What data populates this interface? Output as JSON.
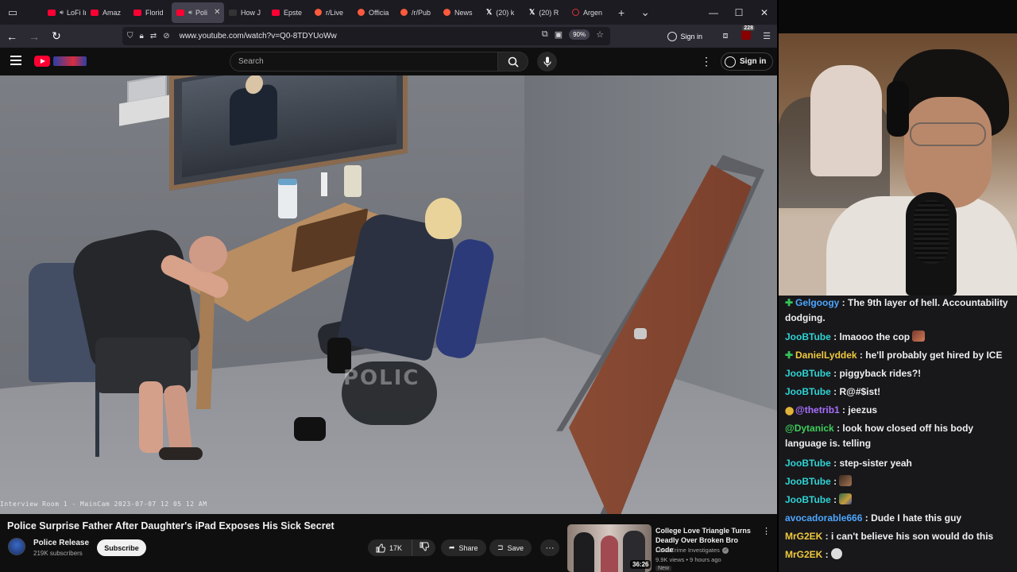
{
  "browser": {
    "tabs": [
      {
        "icon": "youtube",
        "label": "LoFi In",
        "audio": true
      },
      {
        "icon": "youtube",
        "label": "Amaz"
      },
      {
        "icon": "youtube",
        "label": "Florid"
      },
      {
        "icon": "youtube",
        "label": "Poli",
        "audio": true,
        "active": true
      },
      {
        "icon": "dark",
        "label": "How J"
      },
      {
        "icon": "youtube",
        "label": "Epste"
      },
      {
        "icon": "reddit",
        "label": "r/Live"
      },
      {
        "icon": "reddit",
        "label": "Officia"
      },
      {
        "icon": "reddit",
        "label": "/r/Pub"
      },
      {
        "icon": "reddit",
        "label": "News"
      },
      {
        "icon": "x",
        "label": "(20) k"
      },
      {
        "icon": "x",
        "label": "(20) R"
      },
      {
        "icon": "ring",
        "label": "Argen"
      }
    ],
    "url": "www.youtube.com/watch?v=Q0-8TDYUoWw",
    "zoom": "90%",
    "signin_label": "Sign in",
    "ublock_count": "228"
  },
  "youtube": {
    "search_placeholder": "Search",
    "signin_label": "Sign in",
    "video_overlay": "Interview Room 1 - MainCam 2023-07-07 12 05 12 AM",
    "watermark": "POLIC",
    "title": "Police Surprise Father After Daughter's iPad Exposes His Sick Secret",
    "channel": "Police Release",
    "subscribers": "219K subscribers",
    "subscribe_label": "Subscribe",
    "likes": "17K",
    "share_label": "Share",
    "save_label": "Save",
    "recommended": {
      "title": "College Love Triangle Turns Deadly Over Broken Bro Code",
      "channel": "Law&Crime Investigates",
      "meta": "9.9K views • 9 hours ago",
      "badge": "New",
      "duration": "36:26"
    }
  },
  "chat": {
    "colors": {
      "green": "#36c25a",
      "yellow": "#e0b33a",
      "blue": "#4da6ff",
      "purple": "#a970ff",
      "cyan": "#2fd3d3",
      "teal": "#00c8af"
    },
    "messages": [
      {
        "user": "Gelgoogy",
        "text": "The 9th layer of hell. Accountability dodging.",
        "badge": "plus",
        "color": "#4da6ff"
      },
      {
        "user": "JooBTube",
        "text": "lmaooo the cop",
        "color": "#2fd3d3",
        "emote": "cop"
      },
      {
        "user": "DanielLyddek",
        "text": "he'll probably get hired by ICE",
        "badge": "plus",
        "color": "#f0c93d"
      },
      {
        "user": "JooBTube",
        "text": "piggyback rides?!",
        "color": "#2fd3d3"
      },
      {
        "user": "JooBTube",
        "text": "R@#$ist!",
        "color": "#2fd3d3"
      },
      {
        "user": "@thetrib1",
        "text": "jeezus",
        "badge": "coin",
        "color": "#a970ff"
      },
      {
        "user": "@Dytanick",
        "text": "look how closed off his body language is. telling",
        "color": "#3fcf5a"
      },
      {
        "user": "JooBTube",
        "text": "step-sister yeah",
        "color": "#2fd3d3"
      },
      {
        "user": "JooBTube",
        "text": "",
        "color": "#2fd3d3",
        "emote": "face1"
      },
      {
        "user": "JooBTube",
        "text": "",
        "color": "#2fd3d3",
        "emote": "face2"
      },
      {
        "user": "avocadorable666",
        "text": "Dude I hate this guy",
        "color": "#4da6ff"
      },
      {
        "user": "MrG2EK",
        "text": "i can't believe his son would do this",
        "color": "#f0c93d"
      },
      {
        "user": "MrG2EK",
        "text": "",
        "color": "#f0c93d",
        "emote": "skull"
      }
    ]
  }
}
